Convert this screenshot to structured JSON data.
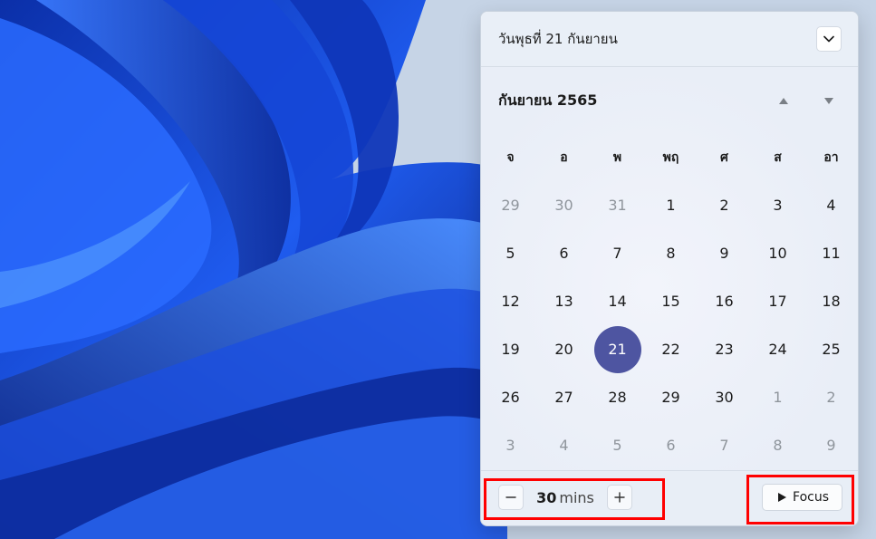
{
  "colors": {
    "accent": "#4e55a1",
    "highlight": "#ff0000",
    "wallpaper_blue": "#1a47d8"
  },
  "header": {
    "date_text": "วันพุธที่ 21 กันยายน",
    "collapse_icon": "chevron-down-icon"
  },
  "calendar": {
    "month_title": "กันยายน 2565",
    "prev_icon": "triangle-up-icon",
    "next_icon": "triangle-down-icon",
    "weekdays": [
      "จ",
      "อ",
      "พ",
      "พฤ",
      "ศ",
      "ส",
      "อา"
    ],
    "weeks": [
      [
        "29",
        "30",
        "31",
        "1",
        "2",
        "3",
        "4"
      ],
      [
        "5",
        "6",
        "7",
        "8",
        "9",
        "10",
        "11"
      ],
      [
        "12",
        "13",
        "14",
        "15",
        "16",
        "17",
        "18"
      ],
      [
        "19",
        "20",
        "21",
        "22",
        "23",
        "24",
        "25"
      ],
      [
        "26",
        "27",
        "28",
        "29",
        "30",
        "1",
        "2"
      ],
      [
        "3",
        "4",
        "5",
        "6",
        "7",
        "8",
        "9"
      ]
    ],
    "selected_day": "21"
  },
  "focus": {
    "minutes_value": "30",
    "minutes_unit": "mins",
    "decrement_label": "−",
    "increment_label": "+",
    "focus_label": "Focus",
    "focus_icon": "play-icon"
  }
}
